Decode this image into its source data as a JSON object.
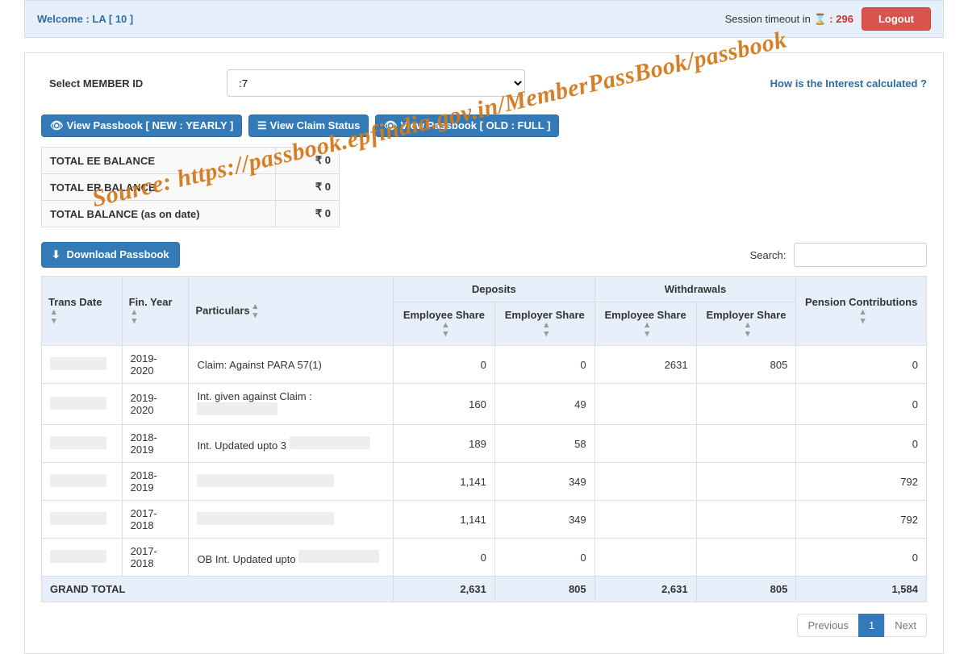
{
  "header": {
    "welcome_prefix": "Welcome : ",
    "user_name": "                        LA",
    "uan_wrapped": "[ 10                  ]",
    "timeout_label": "Session timeout in ",
    "timeout_value": "296",
    "logout": "Logout"
  },
  "member": {
    "label": "Select MEMBER ID",
    "selected": "                                              :7",
    "interest_link": "How is the Interest calculated ?"
  },
  "buttons": {
    "view_new": "View Passbook [ NEW : YEARLY ]",
    "claim_status": "View Claim Status",
    "view_old": "View Passbook [ OLD : FULL ]",
    "download": "Download Passbook"
  },
  "totals": {
    "ee_label": "TOTAL EE BALANCE",
    "ee_value": "₹ 0",
    "er_label": "TOTAL ER BALANCE",
    "er_value": "₹ 0",
    "total_label": "TOTAL BALANCE (as on date)",
    "total_value": "₹ 0"
  },
  "search": {
    "label": "Search:",
    "value": ""
  },
  "columns": {
    "trans_date": "Trans Date",
    "fin_year": "Fin. Year",
    "particulars": "Particulars",
    "deposits_group": "Deposits",
    "withdrawals_group": "Withdrawals",
    "emp_share": "Employee Share",
    "empr_share": "Employer Share",
    "pension": "Pension Contributions"
  },
  "rows": [
    {
      "date": "",
      "fy": "2019-2020",
      "part": "Claim: Against PARA 57(1)",
      "dep_ee": "0",
      "dep_er": "0",
      "wd_ee": "2631",
      "wd_er": "805",
      "pen": "0"
    },
    {
      "date": "",
      "fy": "2019-2020",
      "part": "Int. given against Claim :",
      "dep_ee": "160",
      "dep_er": "49",
      "wd_ee": "",
      "wd_er": "",
      "pen": "0"
    },
    {
      "date": "",
      "fy": "2018-2019",
      "part": "Int. Updated upto 3",
      "dep_ee": "189",
      "dep_er": "58",
      "wd_ee": "",
      "wd_er": "",
      "pen": "0"
    },
    {
      "date": "",
      "fy": "2018-2019",
      "part": "",
      "dep_ee": "1,141",
      "dep_er": "349",
      "wd_ee": "",
      "wd_er": "",
      "pen": "792"
    },
    {
      "date": "",
      "fy": "2017-2018",
      "part": "",
      "dep_ee": "1,141",
      "dep_er": "349",
      "wd_ee": "",
      "wd_er": "",
      "pen": "792"
    },
    {
      "date": "",
      "fy": "2017-2018",
      "part": "OB Int. Updated upto",
      "dep_ee": "0",
      "dep_er": "0",
      "wd_ee": "",
      "wd_er": "",
      "pen": "0"
    }
  ],
  "grand": {
    "label": "GRAND TOTAL",
    "dep_ee": "2,631",
    "dep_er": "805",
    "wd_ee": "2,631",
    "wd_er": "805",
    "pen": "1,584"
  },
  "pagination": {
    "prev": "Previous",
    "page": "1",
    "next": "Next"
  },
  "watermark": "Source: https://passbook.epfindia.gov.in/MemberPassBook/passbook"
}
